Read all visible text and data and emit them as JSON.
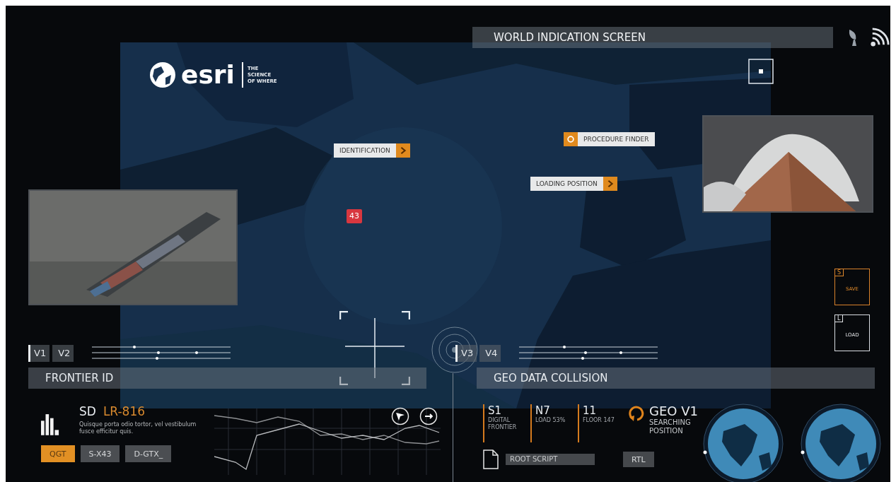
{
  "title_bar": {
    "title": "WORLD INDICATION SCREEN"
  },
  "logo": {
    "name": "esri",
    "tagline": "THE SCIENCE OF WHERE"
  },
  "map_tags": [
    {
      "kind": "arrow",
      "label": "IDENTIFICATION"
    },
    {
      "kind": "finder",
      "label": "PROCEDURE FINDER"
    },
    {
      "kind": "arrow",
      "label": "LOADING POSITION"
    }
  ],
  "map_badge": "43",
  "side_buttons": [
    {
      "key": "S",
      "label": "SAVE",
      "selected": true
    },
    {
      "key": "L",
      "label": "LOAD",
      "selected": false
    }
  ],
  "left_panel": {
    "views": [
      {
        "label": "V1",
        "selected": true
      },
      {
        "label": "V2",
        "selected": false
      }
    ],
    "section": "FRONTIER ID"
  },
  "right_panel": {
    "views": [
      {
        "label": "V3",
        "selected": true
      },
      {
        "label": "V4",
        "selected": false
      }
    ],
    "section": "GEO DATA COLLISION"
  },
  "readout": {
    "prefix": "SD",
    "code": "LR-816",
    "description": "Quisque porta odio tortor, vel vestibulum fusce efficitur quis."
  },
  "modes": [
    {
      "label": "QGT",
      "selected": true
    },
    {
      "label": "S-X43",
      "selected": false
    },
    {
      "label": "D-GTX_",
      "selected": false
    }
  ],
  "stats": [
    {
      "value": "S1",
      "caption": "DIGITAL FRONTIER"
    },
    {
      "value": "N7",
      "caption": "LOAD 53%"
    },
    {
      "value": "11",
      "caption": "FLOOR 147"
    }
  ],
  "geo": {
    "title": "GEO V1",
    "subtitle": "SEARCHING POSITION"
  },
  "root_script": "ROOT SCRIPT",
  "rtl": "RTL"
}
